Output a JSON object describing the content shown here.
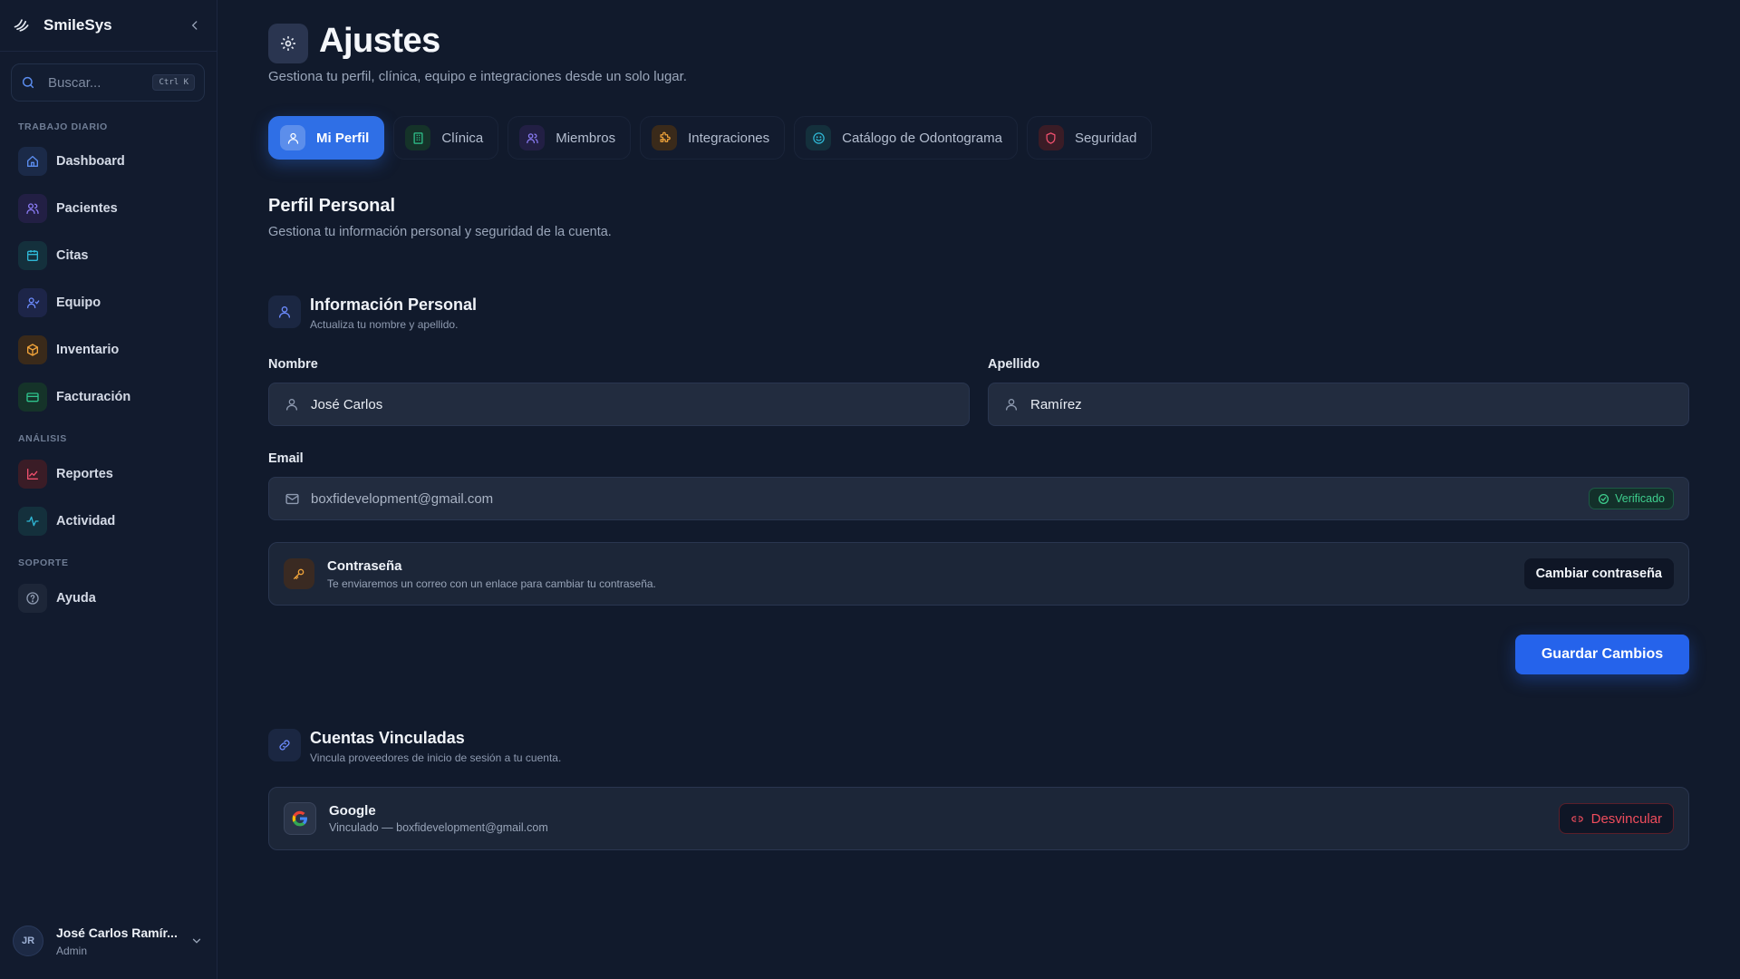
{
  "app": {
    "name": "SmileSys"
  },
  "search": {
    "placeholder": "Buscar...",
    "shortcut": "Ctrl K"
  },
  "sidebar": {
    "sections": [
      {
        "label": "TRABAJO DIARIO"
      },
      {
        "label": "ANÁLISIS"
      },
      {
        "label": "SOPORTE"
      }
    ],
    "items": [
      {
        "label": "Dashboard",
        "icon": "home-icon",
        "color": "#5b8def"
      },
      {
        "label": "Pacientes",
        "icon": "users-icon",
        "color": "#8b7cf6"
      },
      {
        "label": "Citas",
        "icon": "calendar-icon",
        "color": "#2fb8d6"
      },
      {
        "label": "Equipo",
        "icon": "team-icon",
        "color": "#6d8cff"
      },
      {
        "label": "Inventario",
        "icon": "package-icon",
        "color": "#f0a33a"
      },
      {
        "label": "Facturación",
        "icon": "card-icon",
        "color": "#2fc48d"
      },
      {
        "label": "Reportes",
        "icon": "chart-icon",
        "color": "#f0506e"
      },
      {
        "label": "Actividad",
        "icon": "activity-icon",
        "color": "#2fb8d6"
      },
      {
        "label": "Ayuda",
        "icon": "help-icon",
        "color": "#8e9ab0"
      }
    ]
  },
  "user": {
    "initials": "JR",
    "name": "José Carlos Ramír...",
    "role": "Admin"
  },
  "header": {
    "title": "Ajustes",
    "subtitle": "Gestiona tu perfil, clínica, equipo e integraciones desde un solo lugar."
  },
  "tabs": [
    {
      "label": "Mi Perfil",
      "icon": "user-icon",
      "active": true
    },
    {
      "label": "Clínica",
      "icon": "building-icon"
    },
    {
      "label": "Miembros",
      "icon": "members-icon"
    },
    {
      "label": "Integraciones",
      "icon": "puzzle-icon"
    },
    {
      "label": "Catálogo de Odontograma",
      "icon": "smile-icon"
    },
    {
      "label": "Seguridad",
      "icon": "shield-icon"
    }
  ],
  "profile": {
    "title": "Perfil Personal",
    "description": "Gestiona tu información personal y seguridad de la cuenta."
  },
  "personal_info": {
    "title": "Información Personal",
    "subtitle": "Actualiza tu nombre y apellido.",
    "first_name_label": "Nombre",
    "first_name_value": "José Carlos",
    "last_name_label": "Apellido",
    "last_name_value": "Ramírez",
    "email_label": "Email",
    "email_value": "boxfidevelopment@gmail.com",
    "verified_label": "Verificado"
  },
  "password": {
    "title": "Contraseña",
    "description": "Te enviaremos un correo con un enlace para cambiar tu contraseña.",
    "button": "Cambiar contraseña"
  },
  "save_button": "Guardar Cambios",
  "linked": {
    "title": "Cuentas Vinculadas",
    "subtitle": "Vincula proveedores de inicio de sesión a tu cuenta.",
    "provider": "Google",
    "status": "Vinculado — boxfidevelopment@gmail.com",
    "unlink_button": "Desvincular"
  },
  "colors": {
    "accent": "#2f6fe6",
    "primary_button": "#2563eb",
    "success": "#3ecf8e",
    "danger": "#f04d5d",
    "background": "#111a2c"
  }
}
